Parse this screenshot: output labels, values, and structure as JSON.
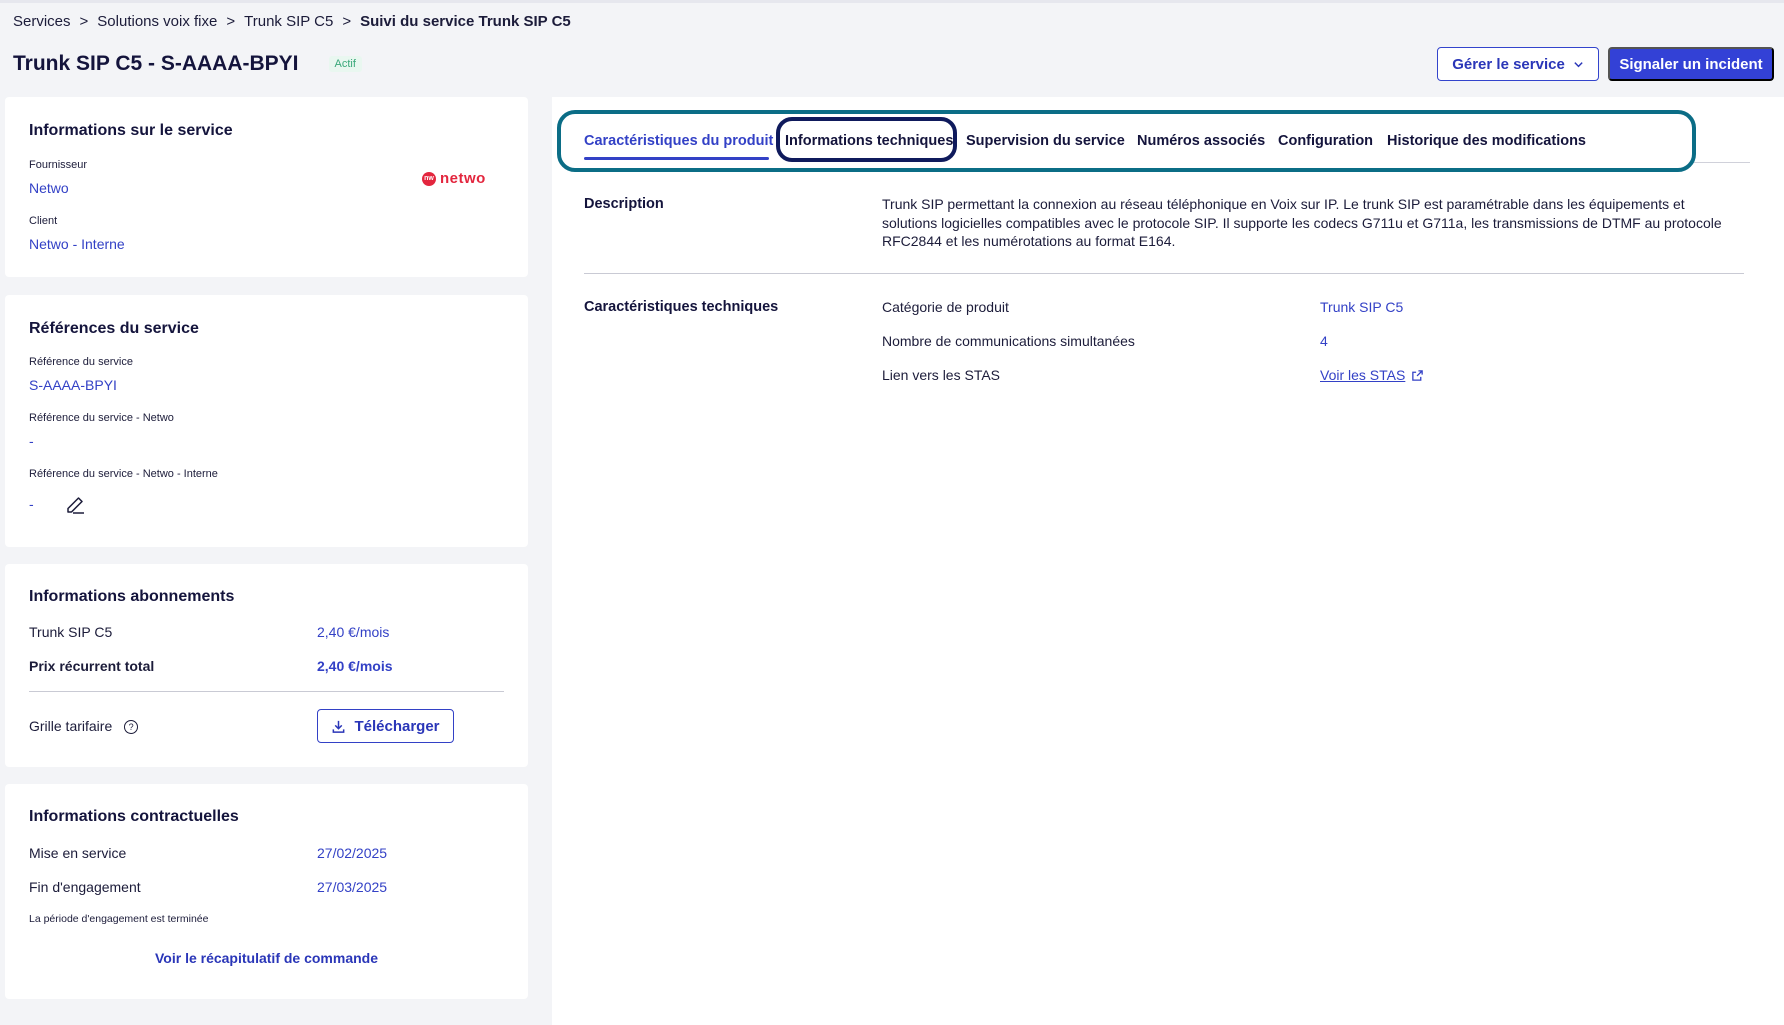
{
  "breadcrumb": {
    "items": [
      "Services",
      "Solutions voix fixe",
      "Trunk SIP C5"
    ],
    "separator": ">",
    "current": "Suivi du service Trunk SIP C5"
  },
  "header": {
    "title": "Trunk SIP C5 - S-AAAA-BPYI",
    "status": "Actif",
    "manage_button": "Gérer le service",
    "incident_button": "Signaler un incident"
  },
  "service_info": {
    "heading": "Informations sur le service",
    "provider_label": "Fournisseur",
    "provider_value": "Netwo",
    "client_label": "Client",
    "client_value": "Netwo - Interne",
    "logo_text": "netwo",
    "logo_mark": "nw"
  },
  "references": {
    "heading": "Références du service",
    "ref_label": "Référence du service",
    "ref_value": "S-AAAA-BPYI",
    "ref_netwo_label": "Référence du service - Netwo",
    "ref_netwo_value": "-",
    "ref_internal_label": "Référence du service - Netwo - Interne",
    "ref_internal_value": "-"
  },
  "subscriptions": {
    "heading": "Informations abonnements",
    "line_label": "Trunk SIP C5",
    "line_value": "2,40 €/mois",
    "total_label": "Prix récurrent total",
    "total_value": "2,40 €/mois",
    "grid_label": "Grille tarifaire",
    "download_button": "Télécharger"
  },
  "contract": {
    "heading": "Informations contractuelles",
    "start_label": "Mise en service",
    "start_value": "27/02/2025",
    "end_label": "Fin d'engagement",
    "end_value": "27/03/2025",
    "note": "La période d'engagement est terminée",
    "summary_link": "Voir le récapitulatif de commande"
  },
  "tabs": [
    {
      "label": "Caractéristiques du produit",
      "active": true
    },
    {
      "label": "Informations techniques",
      "active": false
    },
    {
      "label": "Supervision du service",
      "active": false
    },
    {
      "label": "Numéros associés",
      "active": false
    },
    {
      "label": "Configuration",
      "active": false
    },
    {
      "label": "Historique des modifications",
      "active": false
    }
  ],
  "product": {
    "description_title": "Description",
    "description_text": "Trunk SIP permettant la connexion au réseau téléphonique en Voix sur IP. Le trunk SIP est paramétrable dans les équipements et solutions logicielles compatibles avec le protocole SIP. Il supporte les codecs G711u et G711a, les transmissions de DTMF au protocole RFC2844 et les numérotations au format E164.",
    "tech_title": "Caractéristiques techniques",
    "rows": [
      {
        "label": "Catégorie de produit",
        "value": "Trunk SIP C5"
      },
      {
        "label": "Nombre de communications simultanées",
        "value": "4"
      },
      {
        "label": "Lien vers les STAS",
        "value": "Voir les STAS"
      }
    ]
  },
  "colors": {
    "accent": "#3341c6",
    "highlight": "#0b6d86",
    "focus": "#0f1a5c",
    "brand": "#e3263e"
  }
}
